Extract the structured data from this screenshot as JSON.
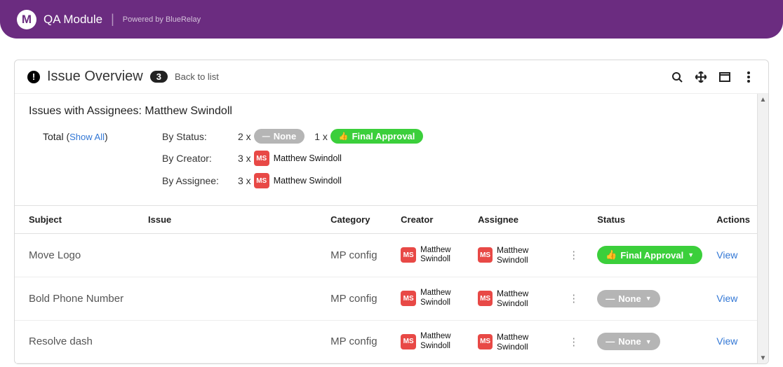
{
  "header": {
    "app_name": "QA Module",
    "powered_by": "Powered by BlueRelay"
  },
  "panel": {
    "title": "Issue Overview",
    "count": "3",
    "back_label": "Back to list"
  },
  "filters": {
    "prefix": "Issues with Assignees:",
    "assignee_name": "Matthew Swindoll",
    "total_label": "Total",
    "show_all": "Show All",
    "by_status_label": "By Status:",
    "status_none_count": "2 x",
    "status_none_label": "None",
    "status_final_count": "1 x",
    "status_final_label": "Final Approval",
    "by_creator_label": "By Creator:",
    "creator_count": "3 x",
    "creator_initials": "MS",
    "creator_name": "Matthew Swindoll",
    "by_assignee_label": "By Assignee:",
    "assignee_count": "3 x",
    "assignee_initials": "MS",
    "assignee_name_full": "Matthew Swindoll"
  },
  "columns": {
    "subject": "Subject",
    "issue": "Issue",
    "category": "Category",
    "creator": "Creator",
    "assignee": "Assignee",
    "status": "Status",
    "actions": "Actions"
  },
  "rows": [
    {
      "subject": "Move Logo",
      "issue": "",
      "category": "MP config",
      "creator_initials": "MS",
      "creator_name": "Matthew Swindoll",
      "assignee_initials": "MS",
      "assignee_name": "Matthew Swindoll",
      "status_label": "Final Approval",
      "status_class": "status-green",
      "status_icon": "👍",
      "view": "View"
    },
    {
      "subject": "Bold Phone Number",
      "issue": "",
      "category": "MP config",
      "creator_initials": "MS",
      "creator_name": "Matthew Swindoll",
      "assignee_initials": "MS",
      "assignee_name": "Matthew Swindoll",
      "status_label": "None",
      "status_class": "status-grey",
      "status_icon": "—",
      "view": "View"
    },
    {
      "subject": "Resolve dash",
      "issue": "",
      "category": "MP config",
      "creator_initials": "MS",
      "creator_name": "Matthew Swindoll",
      "assignee_initials": "MS",
      "assignee_name": "Matthew Swindoll",
      "status_label": "None",
      "status_class": "status-grey",
      "status_icon": "—",
      "view": "View"
    }
  ]
}
